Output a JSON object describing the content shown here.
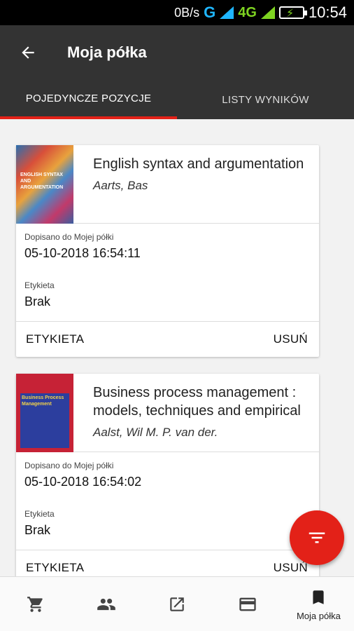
{
  "status_bar": {
    "speed": "0B/s",
    "network": "G",
    "lte": "4G",
    "time": "10:54"
  },
  "toolbar": {
    "title": "Moja półka"
  },
  "tabs": [
    {
      "label": "POJEDYNCZE POZYCJE",
      "active": true
    },
    {
      "label": "LISTY WYNIKÓW",
      "active": false
    }
  ],
  "items": [
    {
      "title": "English syntax and argumentation",
      "author": "Aarts, Bas",
      "added_label": "Dopisano do Mojej półki",
      "added_value": "05-10-2018 16:54:11",
      "tag_label": "Etykieta",
      "tag_value": "Brak",
      "action_tag": "ETYKIETA",
      "action_remove": "USUŃ",
      "cover_text": "ENGLISH SYNTAX AND ARGUMENTATION"
    },
    {
      "title": "Business process management : models, techniques and empirical",
      "author": "Aalst, Wil M. P. van der.",
      "added_label": "Dopisano do Mojej półki",
      "added_value": "05-10-2018 16:54:02",
      "tag_label": "Etykieta",
      "tag_value": "Brak",
      "action_tag": "ETYKIETA",
      "action_remove": "USUŃ",
      "cover_text": "Business Process Management"
    }
  ],
  "bottom_nav": [
    {
      "icon": "cart-icon",
      "label": ""
    },
    {
      "icon": "people-icon",
      "label": ""
    },
    {
      "icon": "open-external-icon",
      "label": ""
    },
    {
      "icon": "card-icon",
      "label": ""
    },
    {
      "icon": "bookmark-icon",
      "label": "Moja półka"
    }
  ],
  "colors": {
    "accent": "#e32118",
    "toolbar": "#333333"
  }
}
